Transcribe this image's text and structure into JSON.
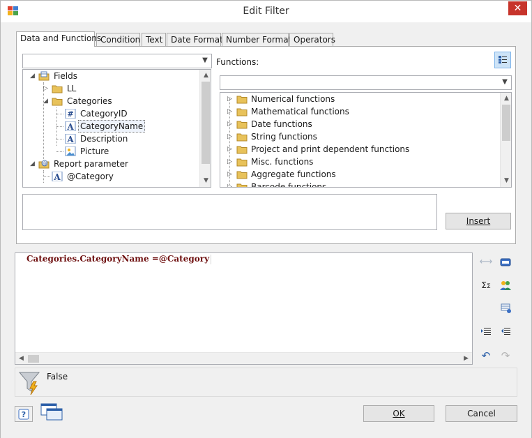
{
  "window": {
    "title": "Edit Filter",
    "close_glyph": "✕"
  },
  "tabs": [
    "Data and Functions",
    "Condition",
    "Text",
    "Date Format",
    "Number Format",
    "Operators"
  ],
  "functions_label": "Functions:",
  "fields_tree": [
    {
      "label": "Fields",
      "icon": "table-icon"
    },
    {
      "label": "LL",
      "icon": "folder-icon"
    },
    {
      "label": "Categories",
      "icon": "folder-icon"
    },
    {
      "label": "CategoryID",
      "icon": "number-field-icon"
    },
    {
      "label": "CategoryName",
      "icon": "text-field-icon"
    },
    {
      "label": "Description",
      "icon": "text-field-icon"
    },
    {
      "label": "Picture",
      "icon": "picture-field-icon"
    },
    {
      "label": "Report parameter",
      "icon": "parameter-icon"
    },
    {
      "label": "@Category",
      "icon": "text-field-icon"
    }
  ],
  "functions_tree": [
    "Numerical functions",
    "Mathematical functions",
    "Date functions",
    "String functions",
    "Project and print dependent functions",
    "Misc. functions",
    "Aggregate functions",
    "Barcode functions"
  ],
  "insert_button": "Insert",
  "expression": {
    "field": "Categories.CategoryName",
    "op": " =@Category"
  },
  "result": "False",
  "buttons": {
    "ok": "OK",
    "cancel": "Cancel"
  },
  "colors": {
    "expression": "#6e0f0f",
    "folder": "#e8c25a",
    "close": "#c7342b"
  }
}
